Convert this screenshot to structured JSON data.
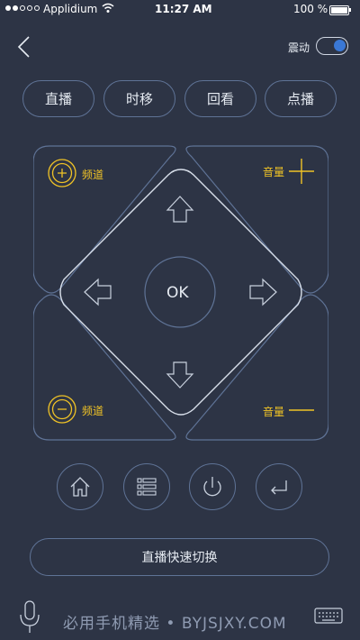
{
  "status": {
    "carrier": "Applidium",
    "time": "11:27 AM",
    "battery": "100 %"
  },
  "header": {
    "vibration_label": "震动",
    "vibration_on": true
  },
  "tabs": [
    {
      "label": "直播"
    },
    {
      "label": "时移"
    },
    {
      "label": "回看"
    },
    {
      "label": "点播"
    }
  ],
  "pad": {
    "ok_label": "OK",
    "channel_up_label": "频道",
    "channel_down_label": "频道",
    "volume_up_label": "音量",
    "volume_down_label": "音量"
  },
  "controls": [
    {
      "name": "home-icon"
    },
    {
      "name": "menu-icon"
    },
    {
      "name": "power-icon"
    },
    {
      "name": "return-icon"
    }
  ],
  "quick_switch_label": "直播快速切换",
  "footer": {
    "watermark": "必用手机精选 • BYJSJXY.COM"
  },
  "colors": {
    "background": "#2d3445",
    "border": "#5f7396",
    "accent_yellow": "#f0c326",
    "toggle_blue": "#3a78d6"
  }
}
